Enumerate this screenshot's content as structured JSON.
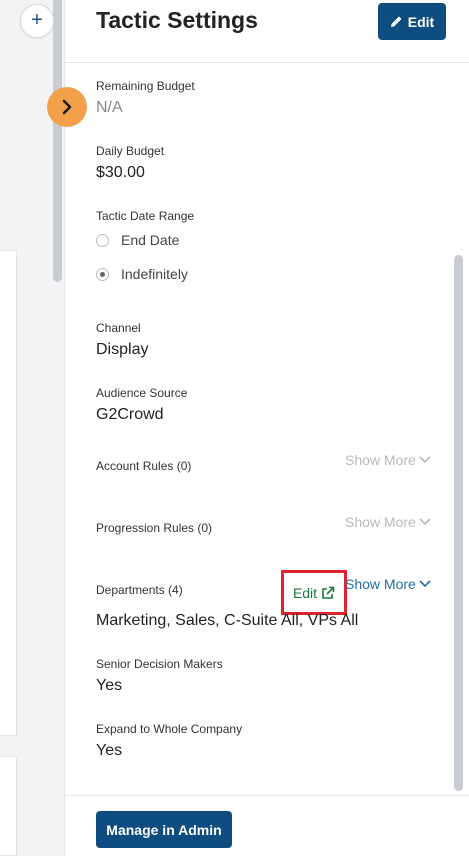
{
  "sidebar": {
    "add_icon": "plus-icon",
    "expand_icon": "chevron-right-icon"
  },
  "panel": {
    "title": "Tactic Settings",
    "edit_label": "Edit",
    "edit_icon": "pencil-icon"
  },
  "fields": {
    "remaining_budget": {
      "label": "Remaining Budget",
      "value": "N/A"
    },
    "daily_budget": {
      "label": "Daily Budget",
      "value": "$30.00"
    },
    "date_range": {
      "label": "Tactic Date Range",
      "options": [
        {
          "label": "End Date",
          "selected": false
        },
        {
          "label": "Indefinitely",
          "selected": true
        }
      ]
    },
    "channel": {
      "label": "Channel",
      "value": "Display"
    },
    "audience_source": {
      "label": "Audience Source",
      "value": "G2Crowd"
    },
    "account_rules": {
      "label": "Account Rules (0)",
      "show_more": "Show More"
    },
    "progression_rules": {
      "label": "Progression Rules (0)",
      "show_more": "Show More"
    },
    "departments": {
      "label": "Departments (4)",
      "edit_link": "Edit",
      "edit_icon": "external-link-icon",
      "show_more": "Show More",
      "value": "Marketing, Sales, C-Suite All, VPs All"
    },
    "senior_decision_makers": {
      "label": "Senior Decision Makers",
      "value": "Yes"
    },
    "expand_company": {
      "label": "Expand to Whole Company",
      "value": "Yes"
    }
  },
  "footer": {
    "manage_label": "Manage in Admin"
  },
  "colors": {
    "primary": "#0f4d80",
    "accent_orange": "#f2a04a",
    "link_blue": "#1f6ea8",
    "link_green": "#1a7a3a",
    "highlight_red": "#e0232b"
  }
}
